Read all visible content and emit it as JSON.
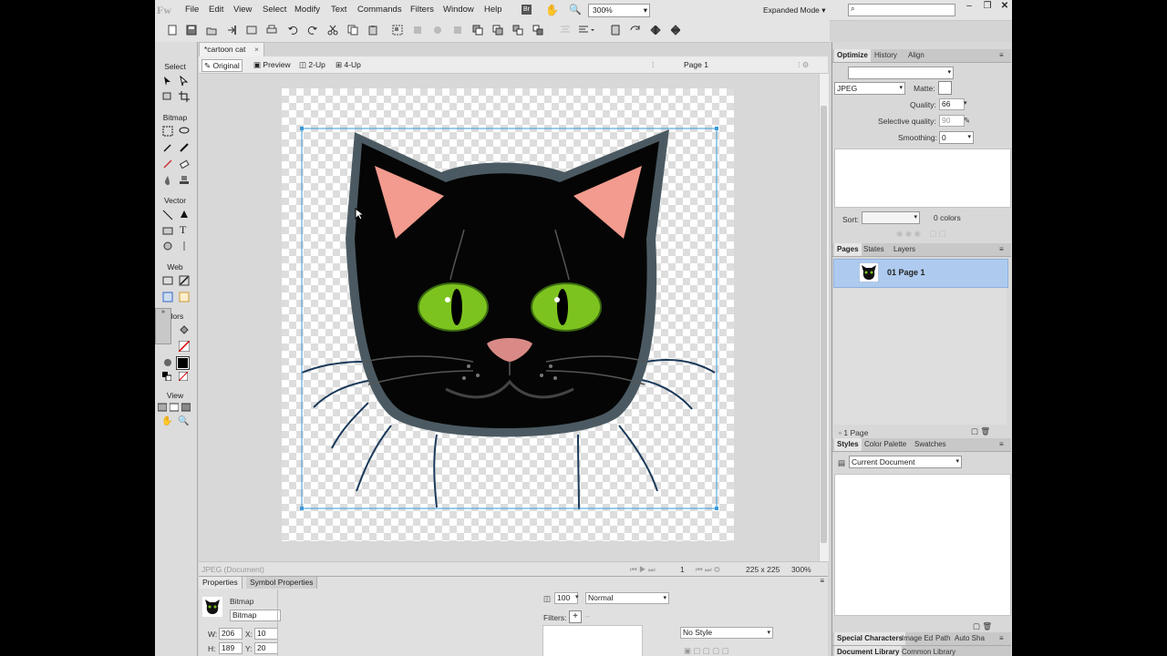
{
  "app": {
    "logo": "Fw"
  },
  "menu": [
    "File",
    "Edit",
    "View",
    "Select",
    "Modify",
    "Text",
    "Commands",
    "Filters",
    "Window",
    "Help"
  ],
  "zoom": "300%",
  "mode": "Expanded Mode",
  "doc": {
    "tab_title": "*cartoon cat",
    "tab_close": "×",
    "views": {
      "original": "Original",
      "preview": "Preview",
      "two_up": "2-Up",
      "four_up": "4-Up"
    },
    "page": "Page 1"
  },
  "tools": {
    "select": "Select",
    "bitmap": "Bitmap",
    "vector": "Vector",
    "web": "Web",
    "colors": "olors",
    "view": "View"
  },
  "status": {
    "doc_type": "JPEG (Document)",
    "page_num": "1",
    "size": "225 x 225",
    "zoom": "300%"
  },
  "properties": {
    "tabs": [
      "Properties",
      "Symbol Properties"
    ],
    "type": "Bitmap",
    "name": "Bitmap",
    "w_label": "W:",
    "w": "206",
    "h_label": "H:",
    "h": "189",
    "x_label": "X:",
    "x": "10",
    "y_label": "Y:",
    "y": "20",
    "opacity": "100",
    "blend": "Normal",
    "filters_label": "Filters:",
    "style": "No Style"
  },
  "optimize": {
    "tabs": [
      "Optimize",
      "History",
      "Align"
    ],
    "format": "JPEG",
    "matte_label": "Matte:",
    "quality_label": "Quality:",
    "quality": "66",
    "selective_label": "Selective quality:",
    "selective": "90",
    "smoothing_label": "Smoothing:",
    "smoothing": "0",
    "sort_label": "Sort:",
    "colors": "0 colors"
  },
  "pages": {
    "tabs": [
      "Pages",
      "States",
      "Layers"
    ],
    "item": "01  Page 1",
    "count": "1 Page"
  },
  "styles": {
    "tabs": [
      "Styles",
      "Color Palette",
      "Swatches"
    ],
    "source": "Current Document"
  },
  "bottom_tabs": [
    "Special Characters",
    "Image Ed",
    "Path",
    "Auto Sha"
  ],
  "bottom_tabs2": [
    "Document Library",
    "Common Library"
  ]
}
